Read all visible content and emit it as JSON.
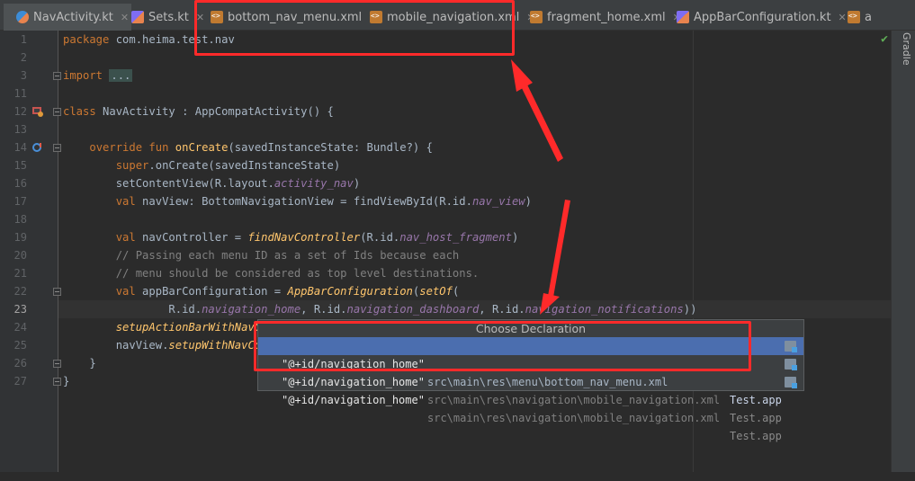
{
  "tabs": [
    {
      "label": "NavActivity.kt",
      "icon": "kotlin-file-icon"
    },
    {
      "label": "Sets.kt",
      "icon": "kotlin-file-icon"
    },
    {
      "label": "bottom_nav_menu.xml",
      "icon": "xml-file-icon"
    },
    {
      "label": "mobile_navigation.xml",
      "icon": "xml-file-icon"
    },
    {
      "label": "fragment_home.xml",
      "icon": "xml-file-icon"
    },
    {
      "label": "AppBarConfiguration.kt",
      "icon": "kotlin-file-icon"
    },
    {
      "label": "a",
      "icon": "xml-file-icon"
    }
  ],
  "side_panel": {
    "label": "Gradle"
  },
  "line_numbers": [
    "1",
    "2",
    "3",
    "11",
    "12",
    "13",
    "14",
    "15",
    "16",
    "17",
    "18",
    "19",
    "20",
    "21",
    "22",
    "23",
    "24",
    "25",
    "26",
    "27"
  ],
  "code": {
    "l1_kw": "package",
    "l1_rest": " com.heima.test.nav",
    "l3_kw": "import",
    "l3_dots": "...",
    "l12_kw": "class",
    "l12_rest": " NavActivity : AppCompatActivity() {",
    "l14_kw": "override fun",
    "l14_fn": "onCreate",
    "l14_rest": "(savedInstanceState: Bundle?) {",
    "l15_kw": "super",
    "l15_rest": ".onCreate(savedInstanceState)",
    "l16_a": "setContentView(R.layout.",
    "l16_it": "activity_nav",
    "l16_b": ")",
    "l17_kw": "val",
    "l17_a": " navView: BottomNavigationView = findViewById(R.id.",
    "l17_it": "nav_view",
    "l17_b": ")",
    "l19_kw": "val",
    "l19_a": " navController = ",
    "l19_fn": "findNavController",
    "l19_b": "(R.id.",
    "l19_it": "nav_host_fragment",
    "l19_c": ")",
    "l20_cm": "// Passing each menu ID as a set of Ids because each",
    "l21_cm": "// menu should be considered as top level destinations.",
    "l22_kw": "val",
    "l22_a": " appBarConfiguration = ",
    "l22_fn": "AppBarConfiguration",
    "l22_b": "(",
    "l22_fn2": "setOf",
    "l22_c": "(",
    "l23_a": "R.id.",
    "l23_it1": "navigation_home",
    "l23_b": ", R.id.",
    "l23_it2": "navigation_dashboard",
    "l23_c": ", R.id.",
    "l23_it3": "navigation_notifications",
    "l23_d": "))",
    "l24_fn": "setupActionBarWithNavCo",
    "l25_a": "navView.",
    "l25_fn": "setupWithNavCon",
    "l26": "}",
    "l27": "}"
  },
  "popup": {
    "title": "Choose Declaration",
    "rows": [
      {
        "id": "\"@+id/navigation_home\"",
        "path": "src\\main\\res\\menu\\bottom_nav_menu.xml",
        "module": "Test.app",
        "selected": true
      },
      {
        "id": "\"@+id/navigation_home\"",
        "path": "src\\main\\res\\navigation\\mobile_navigation.xml",
        "module": "Test.app",
        "selected": false
      },
      {
        "id": "\"@+id/navigation_home\"",
        "path": "src\\main\\res\\navigation\\mobile_navigation.xml",
        "module": "Test.app",
        "selected": false
      }
    ]
  },
  "colors": {
    "annotation": "#ff2a2a",
    "selection": "#4b6eaf",
    "background": "#2b2b2b"
  }
}
